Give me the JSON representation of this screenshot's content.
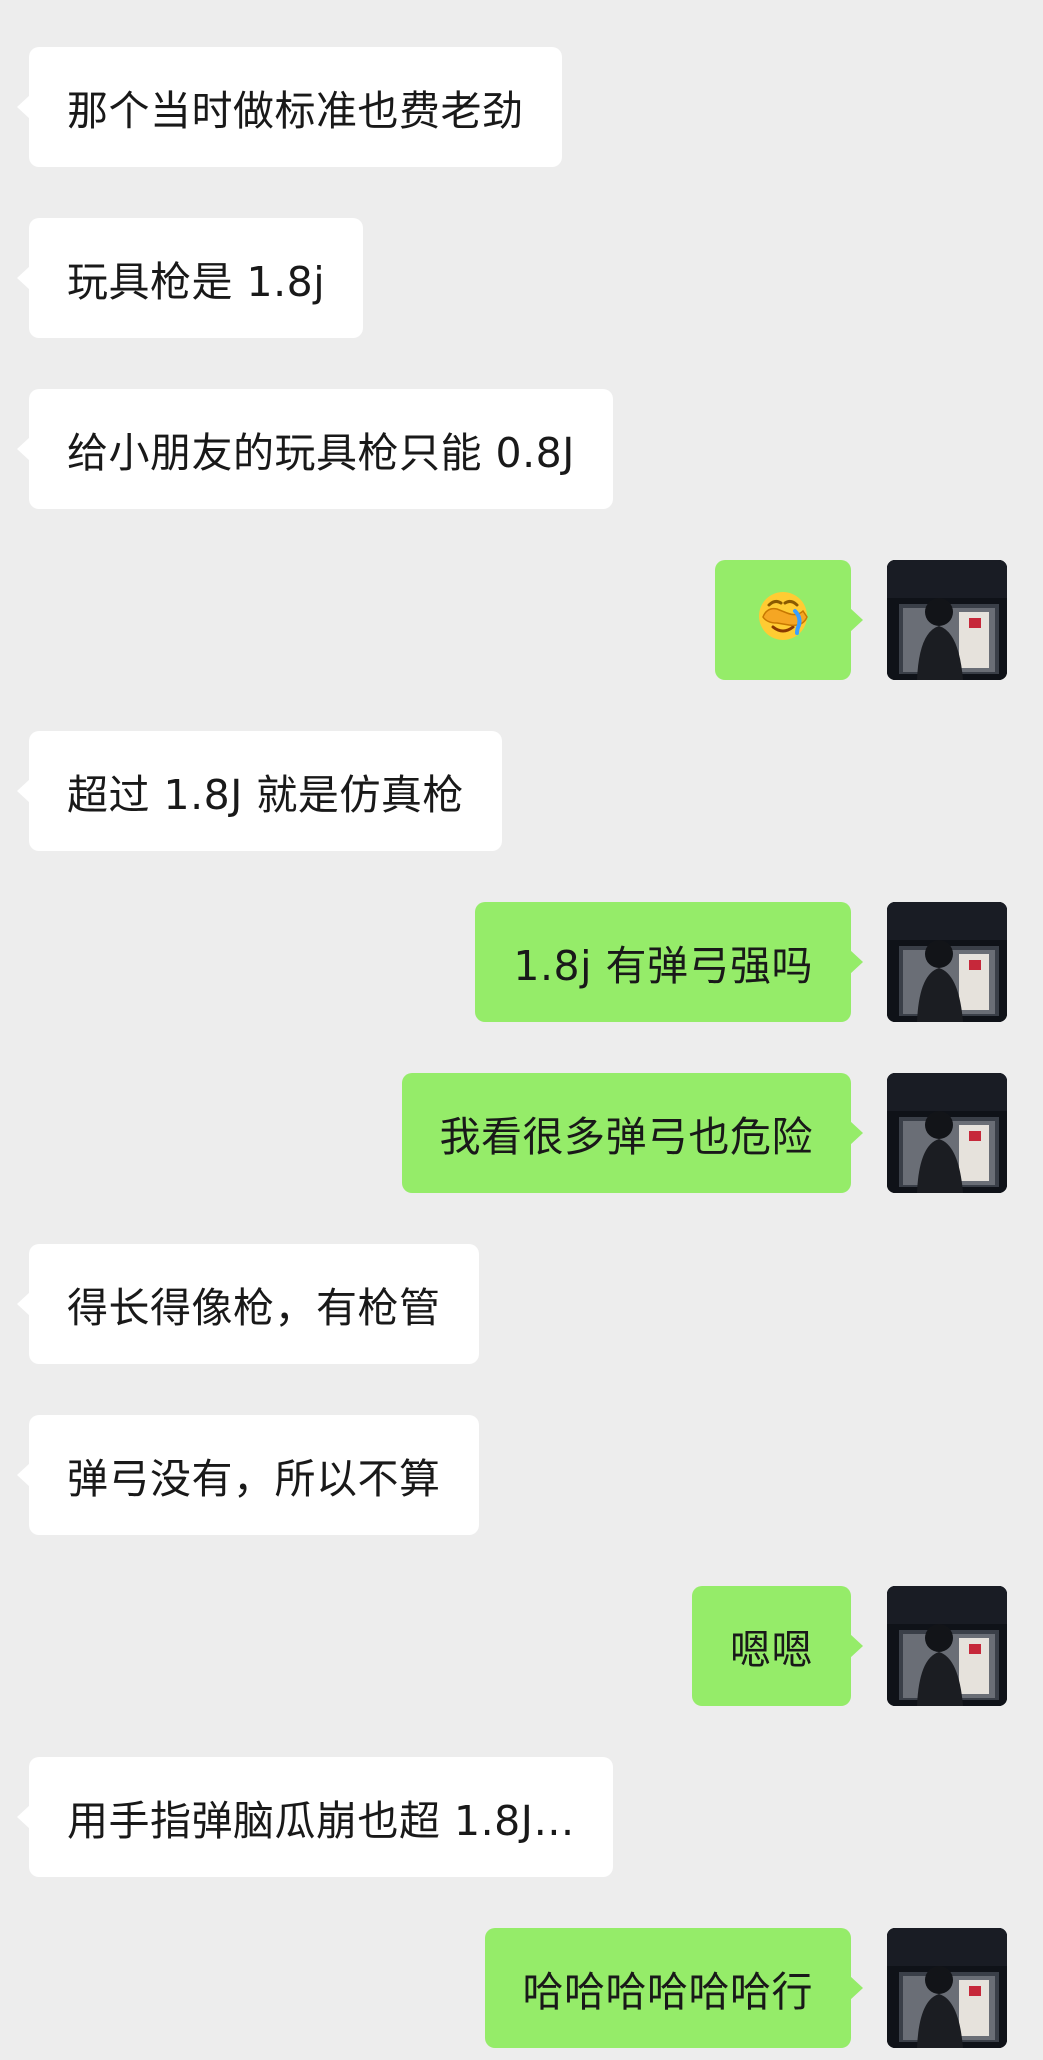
{
  "messages": [
    {
      "side": "in",
      "text": "那个当时做标准也费老劲"
    },
    {
      "side": "in",
      "text": "玩具枪是 1.8j"
    },
    {
      "side": "in",
      "text": "给小朋友的玩具枪只能 0.8J"
    },
    {
      "side": "out",
      "emoji": "facepalm-emoji"
    },
    {
      "side": "in",
      "text": "超过 1.8J 就是仿真枪"
    },
    {
      "side": "out",
      "text": "1.8j 有弹弓强吗"
    },
    {
      "side": "out",
      "text": "我看很多弹弓也危险"
    },
    {
      "side": "in",
      "text": "得长得像枪，有枪管"
    },
    {
      "side": "in",
      "text": "弹弓没有，所以不算"
    },
    {
      "side": "out",
      "text": "嗯嗯"
    },
    {
      "side": "in",
      "text": "用手指弹脑瓜崩也超 1.8J…"
    },
    {
      "side": "out",
      "text": "哈哈哈哈哈哈行"
    }
  ],
  "colors": {
    "background": "#ededed",
    "incoming_bubble": "#ffffff",
    "outgoing_bubble": "#95ec69",
    "text": "#191919"
  }
}
